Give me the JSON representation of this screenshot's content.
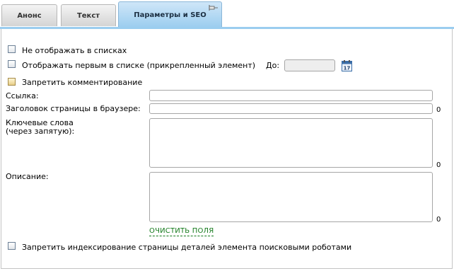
{
  "tabs": [
    {
      "label": "Анонс"
    },
    {
      "label": "Текст"
    },
    {
      "label": "Параметры и SEO",
      "active": true
    }
  ],
  "options": {
    "hide_in_lists": "Не отображать в списках",
    "show_first": "Отображать первым в списке (прикрепленный элемент)",
    "until_label": "До:",
    "until_value": "",
    "disable_comments": "Запретить комментирование",
    "disable_indexing": "Запретить индексирование страницы деталей элемента поисковыми роботами"
  },
  "seo": {
    "link_label": "Ссылка:",
    "link_value": "",
    "title_label": "Заголовок страницы в браузере:",
    "title_value": "",
    "title_count": "0",
    "keywords_label_1": "Ключевые слова",
    "keywords_label_2": "(через запятую):",
    "keywords_value": "",
    "keywords_count": "0",
    "description_label": "Описание:",
    "description_value": "",
    "description_count": "0",
    "clear_link": "ОЧИСТИТЬ ПОЛЯ"
  },
  "icons": {
    "pin": "pin-icon",
    "calendar": "calendar-icon",
    "calendar_text": "17"
  },
  "colors": {
    "active_tab": "#9bcdef",
    "link": "#157a1c"
  }
}
